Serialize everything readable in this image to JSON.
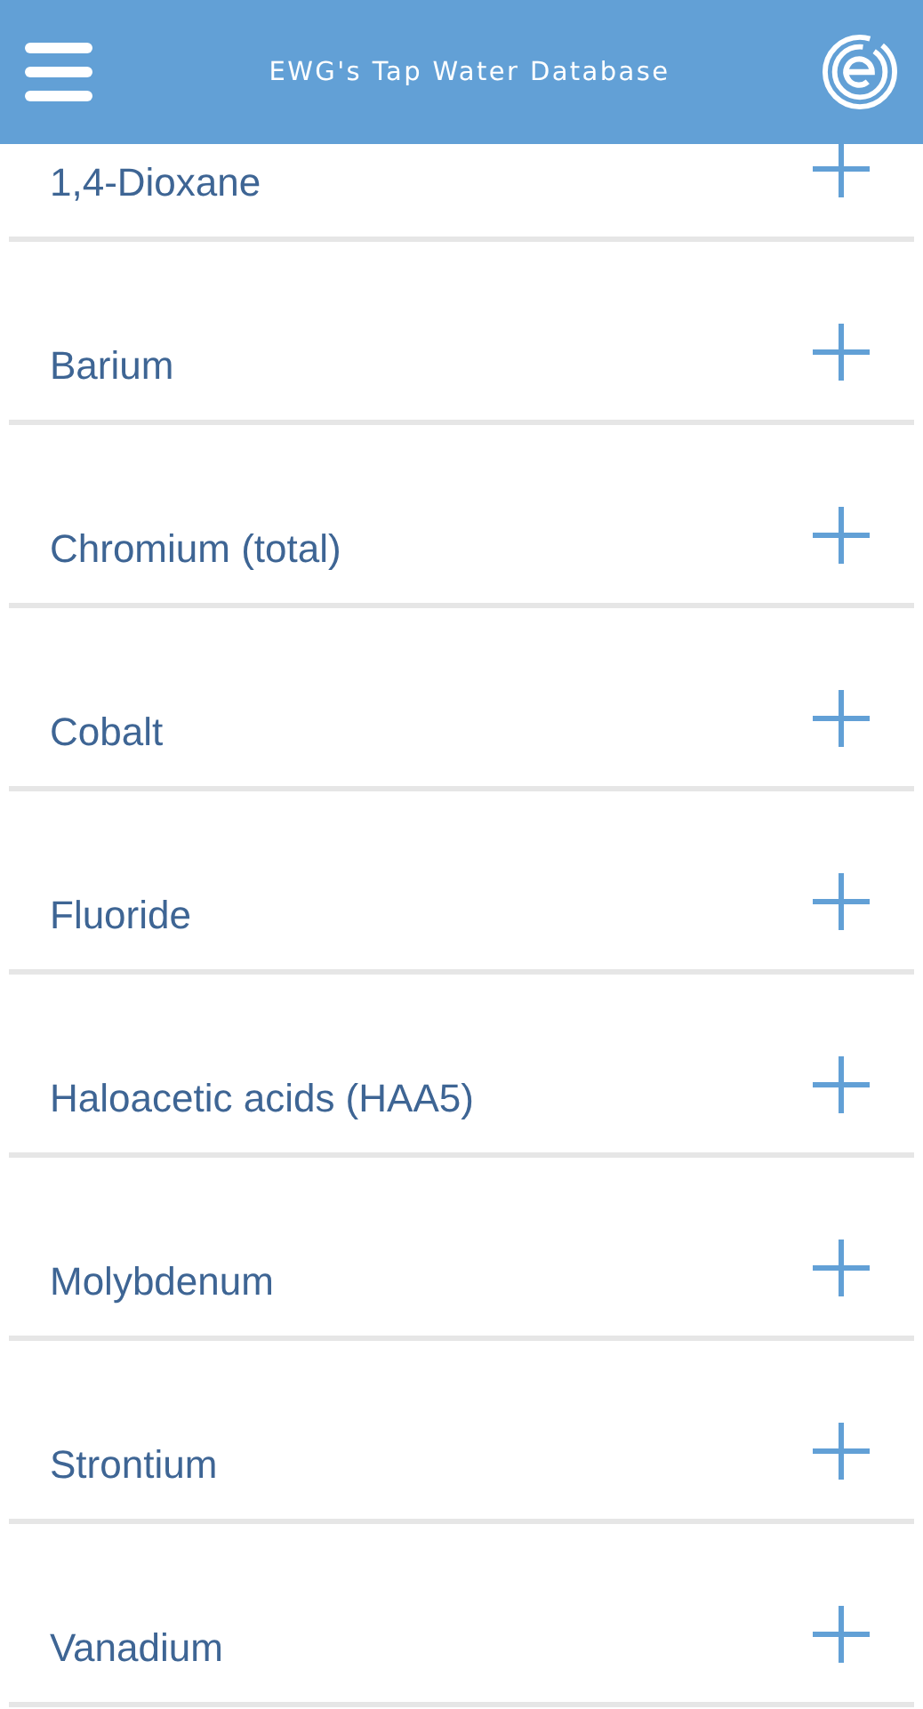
{
  "header": {
    "title": "EWG's Tap Water Database"
  },
  "contaminants": [
    {
      "name": "1,4-Dioxane",
      "expanded": false
    },
    {
      "name": "Barium",
      "expanded": false
    },
    {
      "name": "Chromium (total)",
      "expanded": false
    },
    {
      "name": "Cobalt",
      "expanded": false
    },
    {
      "name": "Fluoride",
      "expanded": false
    },
    {
      "name": "Haloacetic acids (HAA5)",
      "expanded": false
    },
    {
      "name": "Molybdenum",
      "expanded": false
    },
    {
      "name": "Strontium",
      "expanded": false
    },
    {
      "name": "Vanadium",
      "expanded": false
    }
  ]
}
